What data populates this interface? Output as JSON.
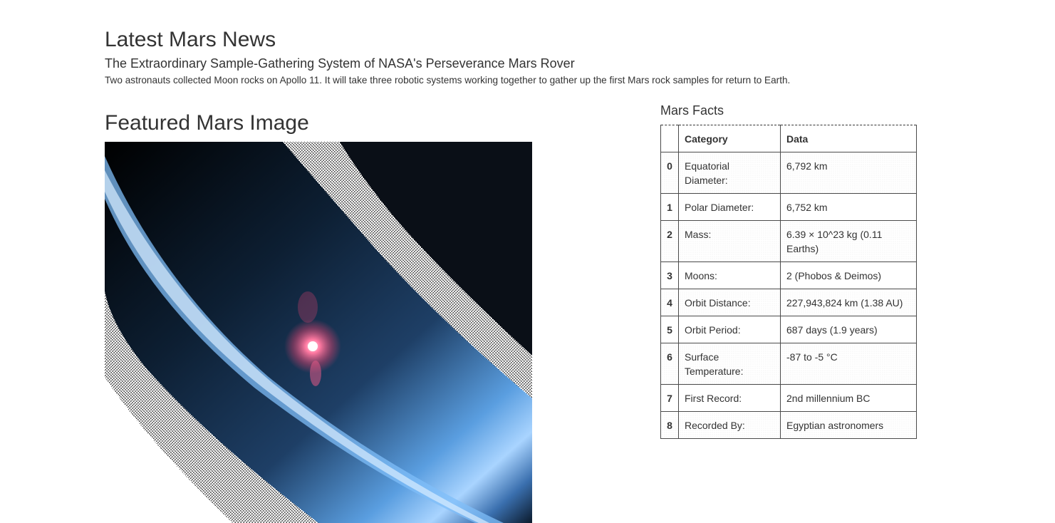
{
  "news": {
    "heading": "Latest Mars News",
    "title": "The Extraordinary Sample-Gathering System of NASA's Perseverance Mars Rover",
    "teaser": "Two astronauts collected Moon rocks on Apollo 11. It will take three robotic systems working together to gather up the first Mars rock samples for return to Earth."
  },
  "featured": {
    "heading": "Featured Mars Image",
    "image_colors": {
      "edge_light": "#bfe0ff",
      "band": "#6ab0f0",
      "deep": "#0b1a2c",
      "spot": "#ff6f9a"
    }
  },
  "facts": {
    "heading": "Mars Facts",
    "columns": [
      "",
      "Category",
      "Data"
    ],
    "rows": [
      {
        "index": "0",
        "category": "Equatorial Diameter:",
        "data": "6,792 km"
      },
      {
        "index": "1",
        "category": "Polar Diameter:",
        "data": "6,752 km"
      },
      {
        "index": "2",
        "category": "Mass:",
        "data": "6.39 × 10^23 kg (0.11 Earths)"
      },
      {
        "index": "3",
        "category": "Moons:",
        "data": "2 (Phobos & Deimos)"
      },
      {
        "index": "4",
        "category": "Orbit Distance:",
        "data": "227,943,824 km (1.38 AU)"
      },
      {
        "index": "5",
        "category": "Orbit Period:",
        "data": "687 days (1.9 years)"
      },
      {
        "index": "6",
        "category": "Surface Temperature:",
        "data": "-87 to -5 °C"
      },
      {
        "index": "7",
        "category": "First Record:",
        "data": "2nd millennium BC"
      },
      {
        "index": "8",
        "category": "Recorded By:",
        "data": "Egyptian astronomers"
      }
    ]
  }
}
